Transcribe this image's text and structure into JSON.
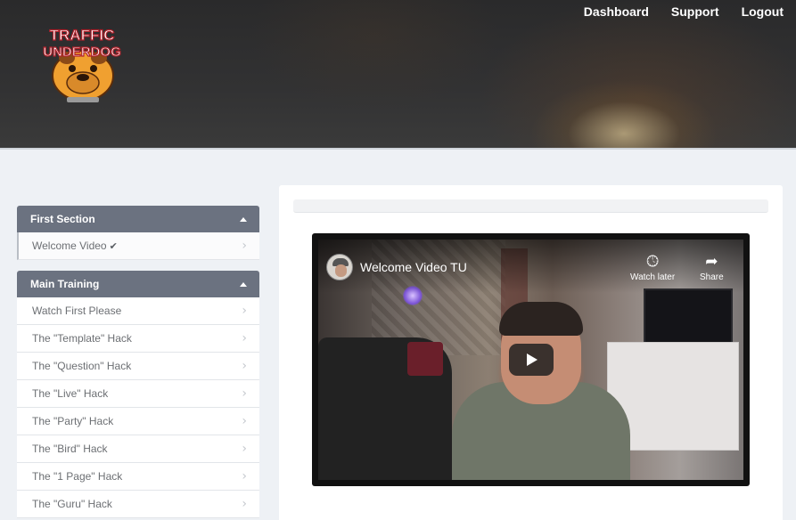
{
  "header": {
    "logo": {
      "line1": "TRAFFIC",
      "line2": "UNDERDOG"
    },
    "nav": [
      {
        "label": "Dashboard"
      },
      {
        "label": "Support"
      },
      {
        "label": "Logout"
      }
    ]
  },
  "sidebar": {
    "sections": [
      {
        "title": "First Section",
        "items": [
          {
            "label": "Welcome Video",
            "completed": true
          }
        ]
      },
      {
        "title": "Main Training",
        "items": [
          {
            "label": "Watch First Please"
          },
          {
            "label": "The \"Template\" Hack"
          },
          {
            "label": "The \"Question\" Hack"
          },
          {
            "label": "The \"Live\" Hack"
          },
          {
            "label": "The \"Party\" Hack"
          },
          {
            "label": "The \"Bird\" Hack"
          },
          {
            "label": "The \"1 Page\" Hack"
          },
          {
            "label": "The \"Guru\" Hack"
          }
        ]
      }
    ]
  },
  "video": {
    "title": "Welcome Video TU",
    "watch_later_label": "Watch later",
    "share_label": "Share"
  },
  "colors": {
    "section_header": "#6b7280",
    "header_bg": "#2e2e2f",
    "page_bg": "#eef1f5"
  }
}
